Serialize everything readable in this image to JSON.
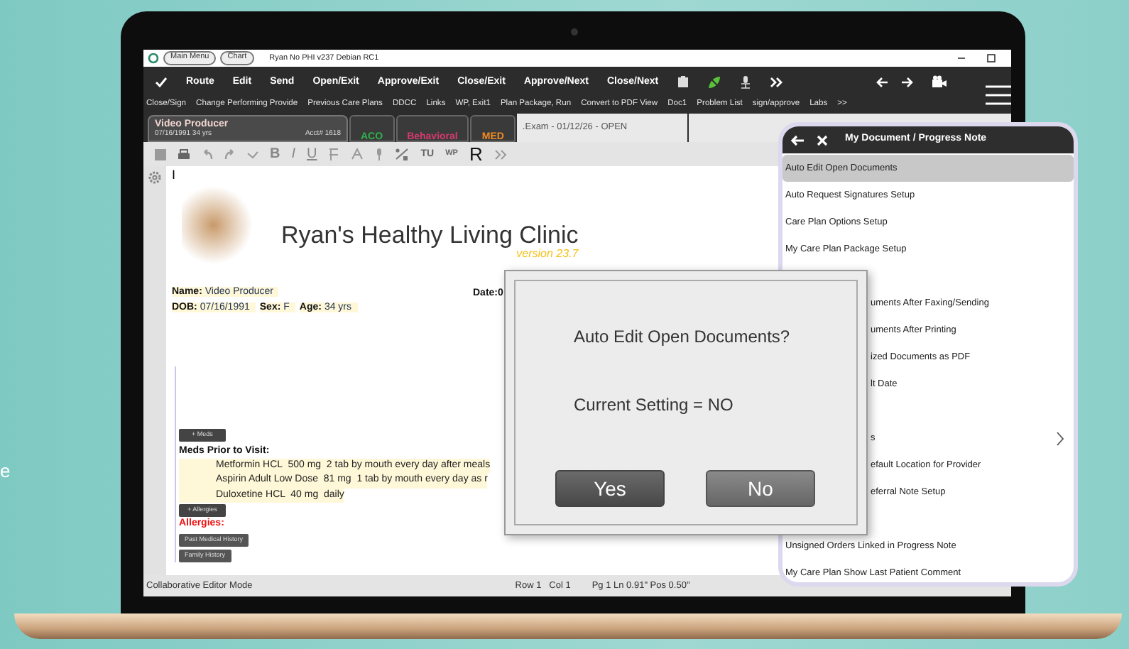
{
  "title_bar": {
    "breadcrumbs": [
      "Main Menu",
      "Chart"
    ],
    "title": "Ryan No PHI v237 Debian RC1"
  },
  "toolbar": {
    "buttons": [
      "Route",
      "Edit",
      "Send",
      "Open/Exit",
      "Approve/Exit",
      "Close/Exit",
      "Approve/Next",
      "Close/Next"
    ]
  },
  "links_bar": [
    "Close/Sign",
    "Change Performing Provide",
    "Previous Care Plans",
    "DDCC",
    "Links",
    "WP, Exit1",
    "Plan Package, Run",
    "Convert to PDF View",
    "Doc1",
    "Problem List",
    "sign/approve",
    "Labs",
    ">>"
  ],
  "patient_tab": {
    "name": "Video Producer",
    "dob": "07/16/1991   34 yrs",
    "account": "Acct# 1618"
  },
  "tabs": [
    {
      "label": "ACO",
      "color": "#2fb24c",
      "selected": false
    },
    {
      "label": "Behavioral",
      "color": "#d63a6c",
      "selected": false
    },
    {
      "label": "MED",
      "color": "#f08a24",
      "selected": false
    },
    {
      "label": ".Exam - 01/12/26 - OPEN",
      "selected": true
    }
  ],
  "format_toolbar": {
    "letters": [
      "B",
      "I",
      "U"
    ],
    "tags": [
      "TU",
      "WP",
      "R"
    ]
  },
  "document": {
    "cursor": "I",
    "clinic_name": "Ryan's Healthy Living Clinic",
    "version": "version 23.7",
    "field_rows": [
      [
        {
          "label": "Name:",
          "value": "Video Producer"
        }
      ],
      [
        {
          "label": "DOB:",
          "value": "07/16/1991"
        },
        {
          "label": "Sex:",
          "value": "F"
        },
        {
          "label": "Age:",
          "value": "34 yrs"
        }
      ]
    ],
    "date_label": "Date:0",
    "meds_button": "+ Meds",
    "meds_heading": "Meds Prior to Visit:",
    "meds": [
      "Metformin HCL  500 mg  2 tab by mouth every day after meals",
      "Aspirin Adult Low Dose  81 mg  1 tab by mouth every day as r",
      "Duloxetine HCL  40 mg  daily"
    ],
    "allergies_button": "+ Allergies",
    "allergies_heading": "Allergies:",
    "section_buttons": [
      "Past Medical History",
      "Family History"
    ]
  },
  "status_bar": {
    "mode": "Collaborative Editor Mode",
    "position": "Row 1   Col 1",
    "page": "Pg 1 Ln 0.91\" Pos 0.50\""
  },
  "side_panel": {
    "title": "My Document / Progress Note",
    "items": [
      {
        "label": "Auto Edit Open Documents",
        "selected": true,
        "kind": "full"
      },
      {
        "label": "Auto Request Signatures Setup",
        "selected": false,
        "kind": "full"
      },
      {
        "label": "Care Plan Options Setup",
        "selected": false,
        "kind": "full"
      },
      {
        "label": "My Care Plan Package Setup",
        "selected": false,
        "kind": "full"
      },
      {
        "label": "uments After Faxing/Sending",
        "selected": false,
        "kind": "cut_after_gap"
      },
      {
        "label": "uments After Printing",
        "selected": false,
        "kind": "cut"
      },
      {
        "label": "ized Documents as PDF",
        "selected": false,
        "kind": "cut"
      },
      {
        "label": "lt Date",
        "selected": false,
        "kind": "cut"
      },
      {
        "label": "s",
        "selected": false,
        "kind": "cut_after_gap"
      },
      {
        "label": "efault Location for Provider",
        "selected": false,
        "kind": "cut"
      },
      {
        "label": "eferral Note Setup",
        "selected": false,
        "kind": "cut"
      },
      {
        "label": "Unsigned Orders Linked in Progress Note",
        "selected": false,
        "kind": "full_after_gap"
      },
      {
        "label": "My Care Plan Show Last Patient Comment",
        "selected": false,
        "kind": "full"
      }
    ]
  },
  "dialog": {
    "question": "Auto Edit Open Documents?",
    "setting": "Current Setting = NO",
    "buttons": [
      "Yes",
      "No"
    ]
  },
  "background_text": "e"
}
